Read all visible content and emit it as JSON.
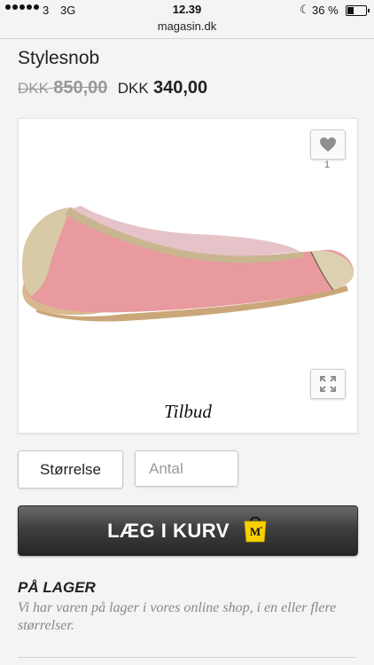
{
  "status_bar": {
    "carrier": "3",
    "network": "3G",
    "time": "12.39",
    "battery": "36 %",
    "battery_level": 0.36
  },
  "browser": {
    "url": "magasin.dk"
  },
  "product": {
    "brand": "Stylesnob",
    "old_currency": "DKK",
    "old_amount": "850,00",
    "new_currency": "DKK",
    "new_amount": "340,00",
    "favorite_count": "1",
    "offer_label": "Tilbud"
  },
  "form": {
    "size_label": "Størrelse",
    "quantity_placeholder": "Antal"
  },
  "cart": {
    "label": "LÆG I KURV"
  },
  "stock": {
    "title": "PÅ LAGER",
    "description": "Vi har varen på lager i vores online shop, i en eller flere størrelser."
  },
  "icons": {
    "heart": "heart-icon",
    "expand": "expand-icon",
    "bag": "magasin-bag-icon",
    "moon": "moon-icon",
    "battery": "battery-icon"
  },
  "colors": {
    "cart_button": "#3f3f3f",
    "bag_yellow": "#f6d200",
    "old_price": "#999999"
  }
}
